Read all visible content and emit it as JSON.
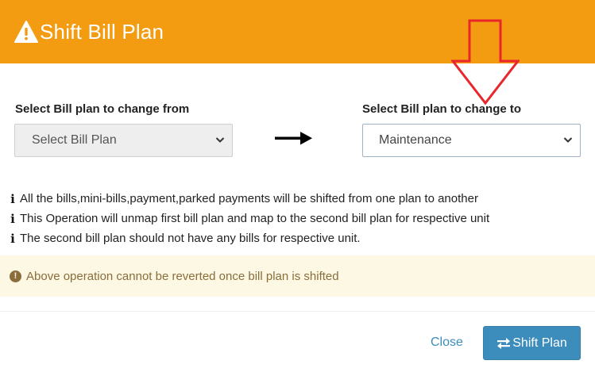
{
  "modal": {
    "title": "Shift Bill Plan",
    "title_icon": "warning-icon"
  },
  "from": {
    "label": "Select Bill plan to change from",
    "selected": "Select Bill Plan"
  },
  "to": {
    "label": "Select Bill plan to change to",
    "selected": "Maintenance"
  },
  "info": [
    "All the bills,mini-bills,payment,parked payments will be shifted from one plan to another",
    "This Operation will unmap first bill plan and map to the second bill plan for respective unit",
    "The second bill plan should not have any bills for respective unit."
  ],
  "alert": {
    "text": "Above operation cannot be reverted once bill plan is shifted"
  },
  "footer": {
    "close_label": "Close",
    "shift_label": "Shift Plan"
  },
  "colors": {
    "header": "#f39c12",
    "primary": "#3c8dbc",
    "alert_bg": "#fcf8e3",
    "alert_text": "#8a6d3b",
    "annotation_arrow": "#e8262b"
  }
}
